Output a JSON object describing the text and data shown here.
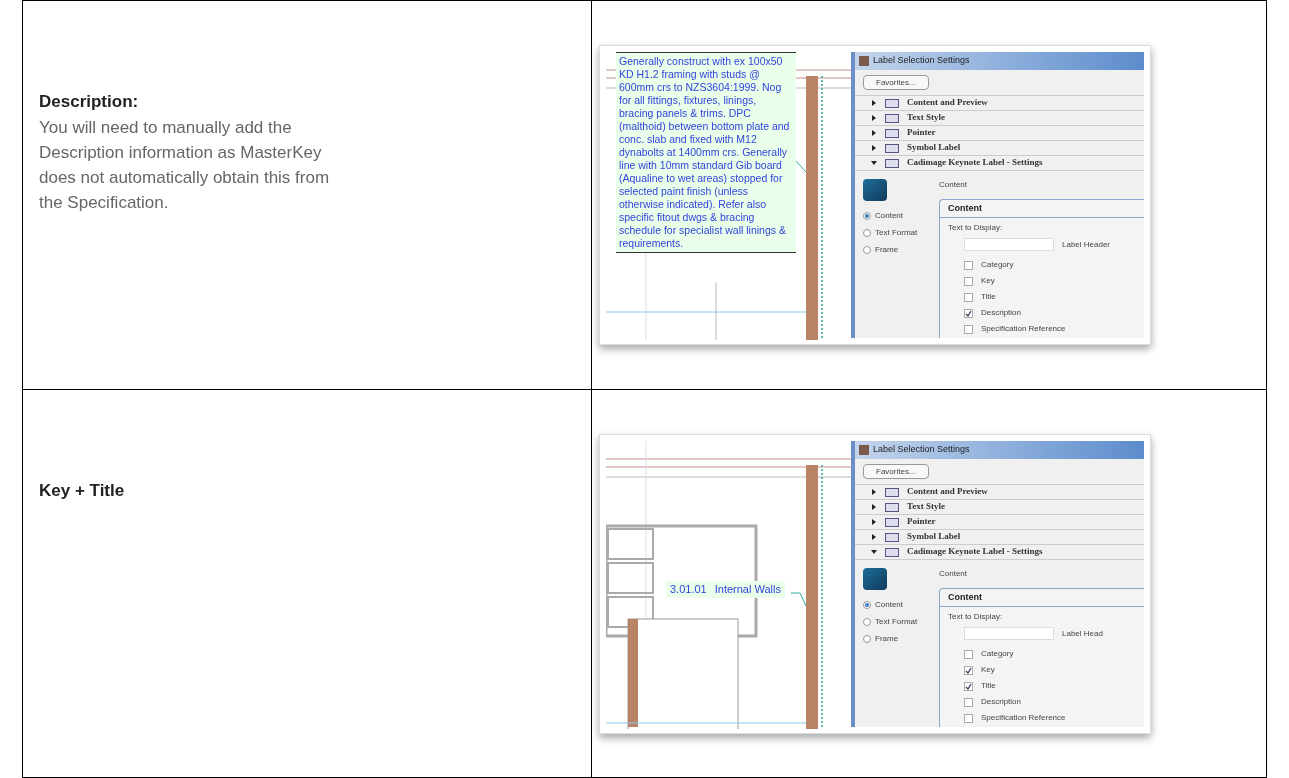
{
  "rows": [
    {
      "heading": "Description:",
      "body": "You will need to manually add the Description information as MasterKey does not automatically obtain this from the Specification.",
      "screenshot": {
        "keynote": {
          "kind": "paragraph",
          "parts": [
            "Generally construct with ex 100x50 KD H1.2 framing with studs @ 600mm crs to NZS3604:1999. Nog for all fittings, fixtures, linings, bracing panels & trims. DPC (malthoid) between bottom plate and conc. slab and fixed with M12 dynabolts at 1400mm crs. Generally line with 10mm standard Gib board (Aqualine to wet areas) stopped for selected paint finish (unless otherwise indicated). Refer also specific fitout dwgs & bracing schedule for specialist wall linings & requirements."
          ]
        },
        "dialog_title": "Label Selection Settings",
        "favorites": "Favorites...",
        "sections": [
          {
            "label": "Content and Preview",
            "expanded": false
          },
          {
            "label": "Text Style",
            "expanded": false
          },
          {
            "label": "Pointer",
            "expanded": false
          },
          {
            "label": "Symbol Label",
            "expanded": false
          },
          {
            "label": "Cadimage Keynote Label - Settings",
            "expanded": true
          }
        ],
        "caption": "Content",
        "radios": [
          {
            "label": "Content",
            "selected": true
          },
          {
            "label": "Text Format",
            "selected": false
          },
          {
            "label": "Frame",
            "selected": false
          }
        ],
        "panel_title": "Content",
        "text_to_display": "Text to Display:",
        "label_header": "Label Header",
        "checkboxes": [
          {
            "label": "Category",
            "checked": false
          },
          {
            "label": "Key",
            "checked": false
          },
          {
            "label": "Title",
            "checked": false
          },
          {
            "label": "Description",
            "checked": true
          },
          {
            "label": "Specification Reference",
            "checked": false
          }
        ]
      }
    },
    {
      "heading": "Key + Title",
      "screenshot": {
        "keynote": {
          "kind": "line",
          "parts": [
            "3.01.01",
            "Internal Walls"
          ]
        },
        "dialog_title": "Label Selection Settings",
        "favorites": "Favorites...",
        "sections": [
          {
            "label": "Content and Preview",
            "expanded": false
          },
          {
            "label": "Text Style",
            "expanded": false
          },
          {
            "label": "Pointer",
            "expanded": false
          },
          {
            "label": "Symbol Label",
            "expanded": false
          },
          {
            "label": "Cadimage Keynote Label - Settings",
            "expanded": true
          }
        ],
        "caption": "Content",
        "radios": [
          {
            "label": "Content",
            "selected": true
          },
          {
            "label": "Text Format",
            "selected": false
          },
          {
            "label": "Frame",
            "selected": false
          }
        ],
        "panel_title": "Content",
        "text_to_display": "Text to Display:",
        "label_header": "Label Head",
        "checkboxes": [
          {
            "label": "Category",
            "checked": false
          },
          {
            "label": "Key",
            "checked": true
          },
          {
            "label": "Title",
            "checked": true
          },
          {
            "label": "Description",
            "checked": false
          },
          {
            "label": "Specification Reference",
            "checked": false
          }
        ]
      }
    }
  ]
}
